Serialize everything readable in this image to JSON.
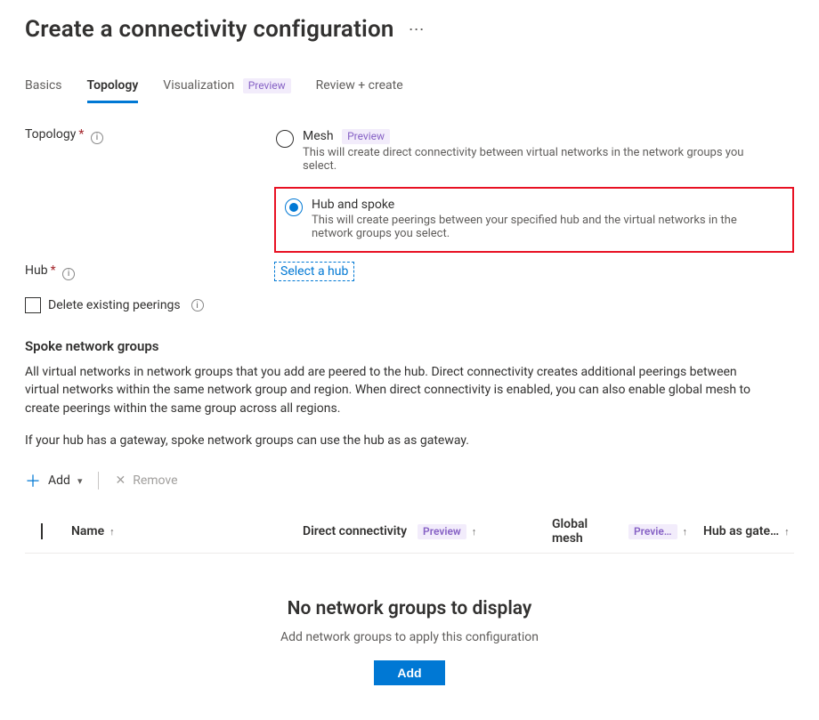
{
  "header": {
    "title": "Create a connectivity configuration"
  },
  "tabs": {
    "basics": "Basics",
    "topology": "Topology",
    "visualization": "Visualization",
    "visualization_badge": "Preview",
    "review": "Review + create",
    "active": "topology"
  },
  "topology": {
    "label": "Topology",
    "options": {
      "mesh": {
        "title": "Mesh",
        "badge": "Preview",
        "desc": "This will create direct connectivity between virtual networks in the network groups you select."
      },
      "hub_spoke": {
        "title": "Hub and spoke",
        "desc": "This will create peerings between your specified hub and the virtual networks in the network groups you select."
      }
    }
  },
  "hub": {
    "label": "Hub",
    "select_link": "Select a hub"
  },
  "delete_peerings": {
    "label": "Delete existing peerings"
  },
  "spoke": {
    "title": "Spoke network groups",
    "desc1": "All virtual networks in network groups that you add are peered to the hub. Direct connectivity creates additional peerings between virtual networks within the same network group and region. When direct connectivity is enabled, you can also enable global mesh to create peerings within the same group across all regions.",
    "desc2": "If your hub has a gateway, spoke network groups can use the hub as as gateway."
  },
  "toolbar": {
    "add": "Add",
    "remove": "Remove"
  },
  "table": {
    "columns": {
      "name": "Name",
      "direct": "Direct connectivity",
      "direct_badge": "Preview",
      "global": "Global mesh",
      "global_badge": "Previe…",
      "hubgw": "Hub as gate…"
    },
    "rows": []
  },
  "empty": {
    "title": "No network groups to display",
    "subtitle": "Add network groups to apply this configuration",
    "button": "Add"
  }
}
